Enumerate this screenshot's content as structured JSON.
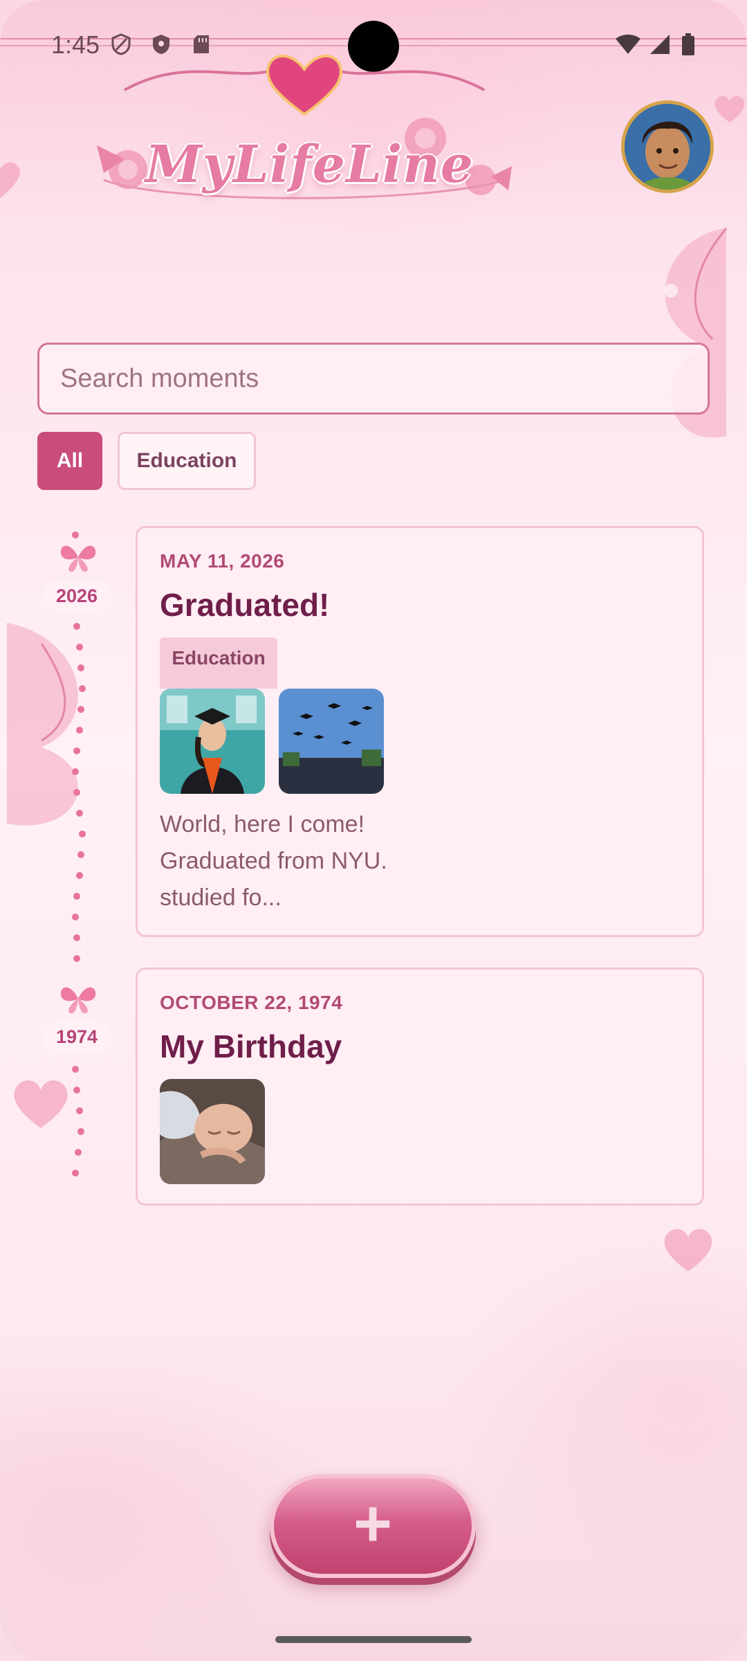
{
  "status_bar": {
    "time": "1:45"
  },
  "app": {
    "logo_text": "MyLifeLine"
  },
  "search": {
    "placeholder": "Search moments",
    "value": ""
  },
  "filters": [
    {
      "label": "All",
      "selected": true
    },
    {
      "label": "Education",
      "selected": false
    }
  ],
  "moments": [
    {
      "year": "2026",
      "date": "MAY 11, 2026",
      "title": "Graduated!",
      "tag": "Education",
      "description": "World, here I come! Graduated from NYU. studied fo...",
      "photos": [
        "graduate-portrait",
        "graduation-caps-toss"
      ]
    },
    {
      "year": "1974",
      "date": "OCTOBER 22, 1974",
      "title": "My Birthday",
      "photos": [
        "newborn-baby"
      ]
    }
  ],
  "fab": {
    "label": "+"
  },
  "colors": {
    "accent": "#c94c7c",
    "title": "#6f1e4a",
    "date": "#b14a74",
    "border": "#f2c4d5"
  }
}
